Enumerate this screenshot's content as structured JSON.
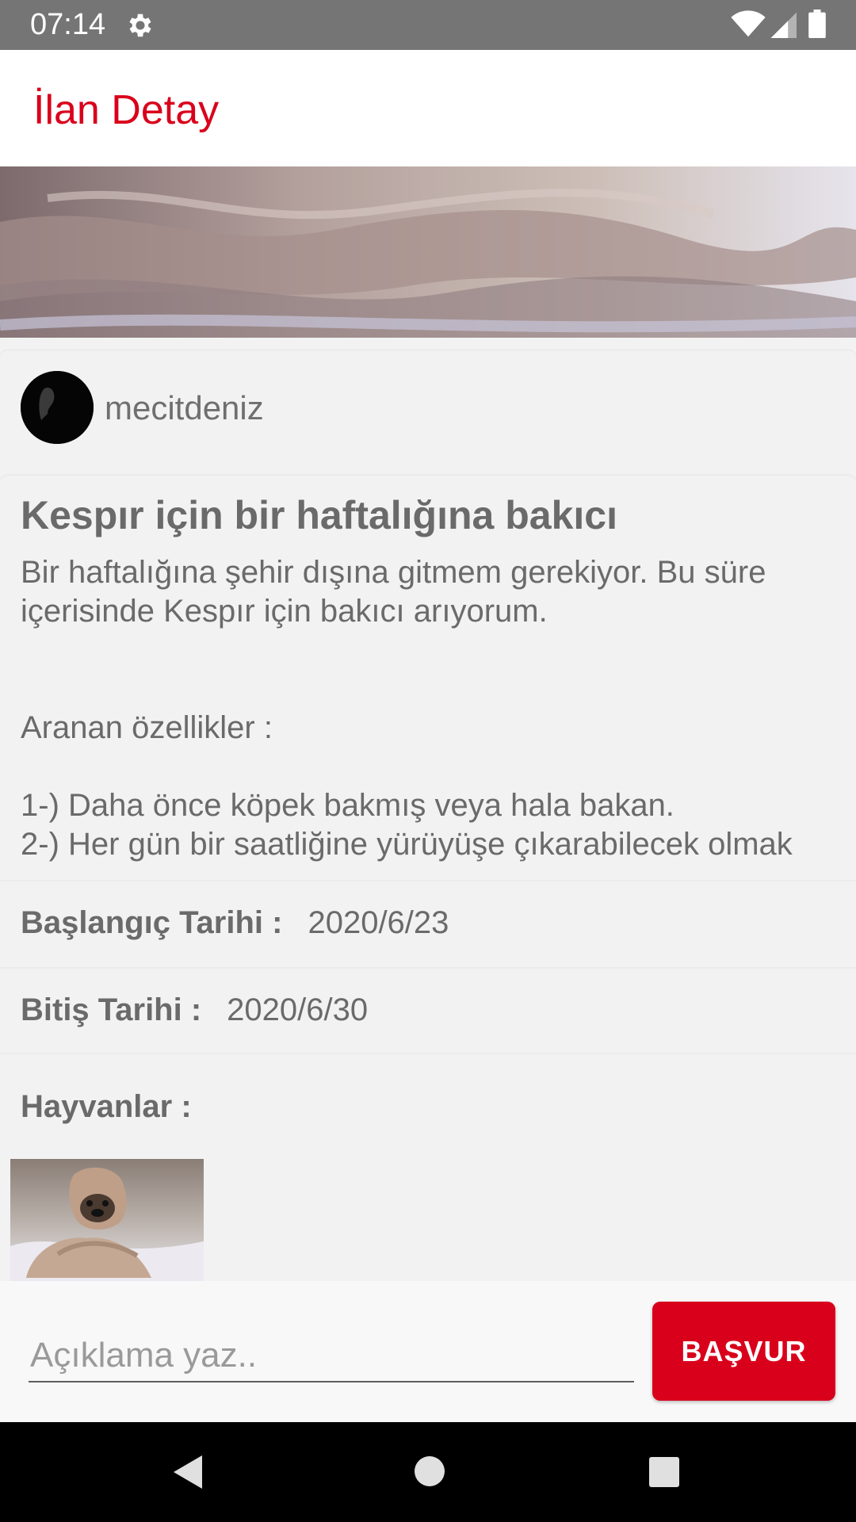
{
  "status_bar": {
    "time": "07:14",
    "icons": [
      "gear-icon",
      "wifi-icon",
      "signal-icon",
      "battery-icon"
    ]
  },
  "app_bar": {
    "title": "İlan Detay"
  },
  "colors": {
    "accent": "#d9001b",
    "card_bg": "#f2f2f2",
    "text": "#6a6a6a"
  },
  "user": {
    "username": "mecitdeniz"
  },
  "post": {
    "title": "Kespır için bir haftalığına bakıcı",
    "description": "Bir haftalığına şehir dışına gitmem gerekiyor. Bu süre içerisinde Kespır için bakıcı arıyorum.\n\n\nAranan özellikler :\n\n1-) Daha önce köpek bakmış veya hala bakan.\n2-) Her gün bir saatliğine yürüyüşe çıkarabilecek olmak",
    "start_label": "Başlangıç Tarihi :",
    "start_date": "2020/6/23",
    "end_label": "Bitiş Tarihi :",
    "end_date": "2020/6/30",
    "animals_label": "Hayvanlar :"
  },
  "bottom": {
    "placeholder": "Açıklama yaz..",
    "apply_label": "BAŞVUR"
  },
  "nav": {
    "icons": [
      "back-icon",
      "home-icon",
      "recents-icon"
    ]
  }
}
